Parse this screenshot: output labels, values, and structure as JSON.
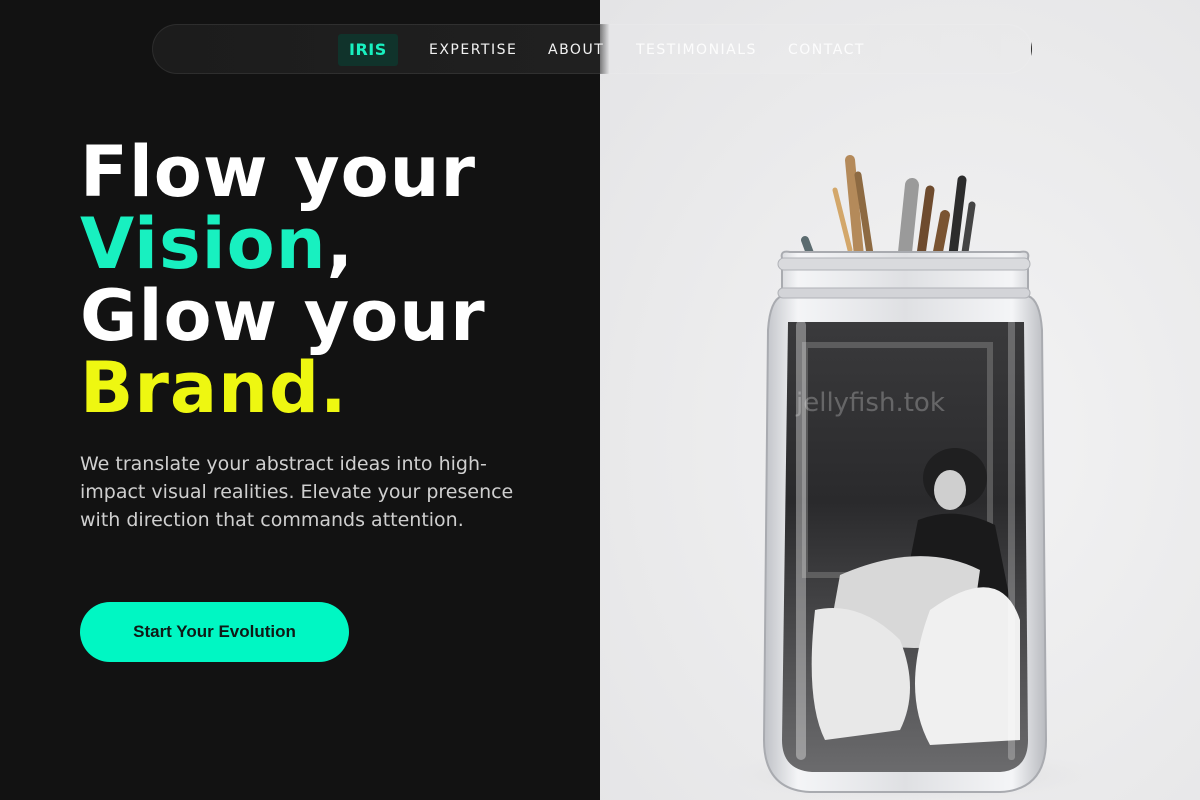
{
  "nav": {
    "brand": "IRIS",
    "links": [
      "EXPERTISE",
      "ABOUT",
      "TESTIMONIALS",
      "CONTACT"
    ]
  },
  "hero": {
    "line1": "Flow your",
    "line2_accent": "Vision",
    "line2_rest": ",",
    "line3": "Glow your",
    "line4_accent": "Brand.",
    "subtext": "We translate your abstract ideas into high-impact visual realities. Elevate your presence with direction that commands attention.",
    "cta_label": "Start Your Evolution"
  },
  "photo": {
    "subject": "glass jar with paint brushes and black-and-white photograph",
    "watermark": "jellyfish.tok"
  },
  "colors": {
    "background": "#121212",
    "accent_green": "#18f0c0",
    "accent_yellow": "#eef711",
    "cta": "#00f7c3",
    "right_panel": "#ebebec"
  }
}
